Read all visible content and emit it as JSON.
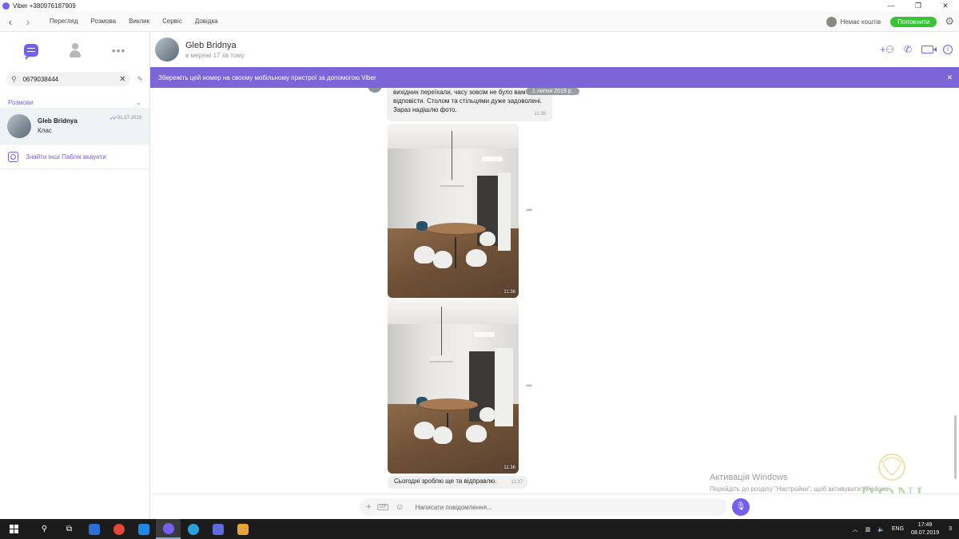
{
  "window": {
    "title": "Viber +380976187909",
    "controls": [
      "—",
      "❐",
      "✕"
    ]
  },
  "menu": {
    "items": [
      "Перегляд",
      "Розмова",
      "Виклик",
      "Сервіс",
      "Довідка"
    ],
    "wallet": "Немає коштів",
    "topup": "Поповнити"
  },
  "sidebar": {
    "search_value": "0679038444",
    "section": "Розмови",
    "chats": [
      {
        "name": "Gleb Bridnya",
        "preview": "Клас",
        "date": "01.07.2019"
      }
    ],
    "public_link": "Знайти інші Паблік акаунти"
  },
  "header": {
    "name": "Gleb Bridnya",
    "status": "в мережі 17 хв тому"
  },
  "banner": {
    "text": "Збережіть цей номер на своєму мобільному пристрої за допомогою Viber"
  },
  "messages": {
    "text1": "вихідних переїхали, часу зовсім не було вам відповісти. Столом та стільцями дуже задоволені. Зараз надішлю фото.",
    "text1_time": "11:36",
    "date_pill": "1 липня 2019 р.",
    "photo1_time": "11:36",
    "photo2_time": "11:36",
    "text2": "Сьогодні зроблю ще та відправлю.",
    "text2_time": "11:37"
  },
  "input": {
    "placeholder": "Написати повідомлення..."
  },
  "watermark": {
    "line1": "Активація Windows",
    "line2": "Перейдіть до розділу \"Настройки\", щоб активувати Windows.",
    "logo_text": "RONI"
  },
  "taskbar": {
    "lang": "ENG",
    "time": "17:49",
    "date": "08.07.2019",
    "notifications": "3"
  },
  "colors": {
    "accent": "#7360f2",
    "banner": "#7c65d6",
    "topup": "#36c436"
  }
}
